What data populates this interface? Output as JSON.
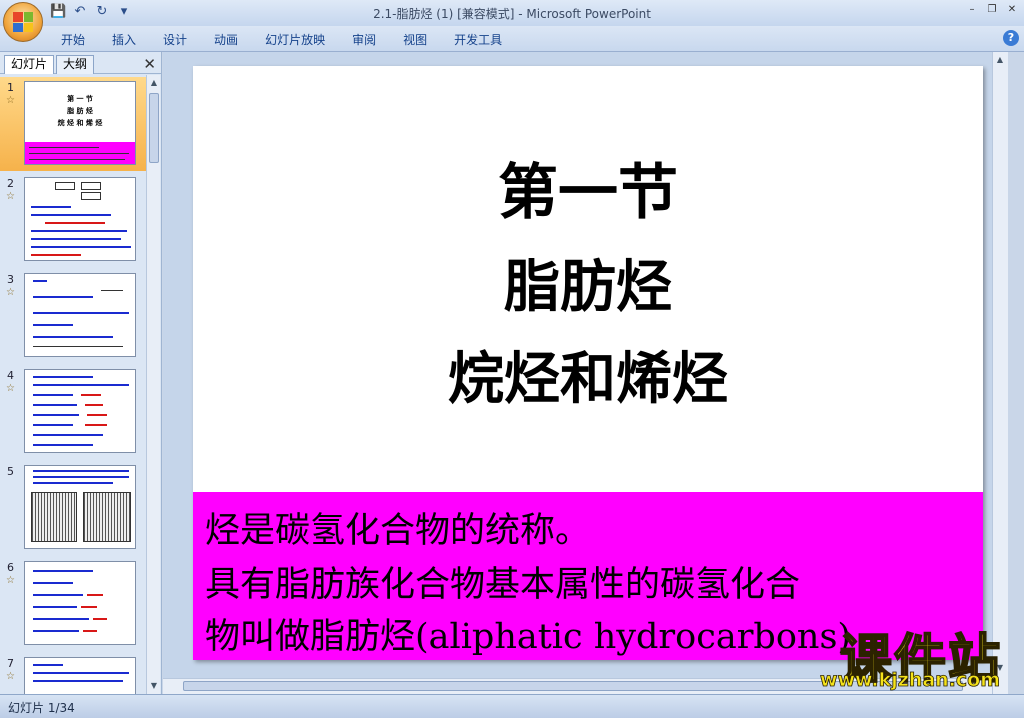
{
  "window": {
    "title": "2.1-脂肪烃 (1) [兼容模式] - Microsoft PowerPoint",
    "controls": [
      "–",
      "❐",
      "✕"
    ]
  },
  "quick_access": {
    "icons": [
      "save-icon",
      "undo-icon",
      "redo-icon",
      "customize-icon"
    ],
    "glyphs": [
      "💾",
      "↶",
      "↻",
      "▾"
    ]
  },
  "ribbon": {
    "tabs": [
      "开始",
      "插入",
      "设计",
      "动画",
      "幻灯片放映",
      "审阅",
      "视图",
      "开发工具"
    ],
    "help_label": "?"
  },
  "left_panel": {
    "tabs": [
      "幻灯片",
      "大纲"
    ],
    "close_label": "✕",
    "thumbnails": [
      {
        "number": "1",
        "selected": true
      },
      {
        "number": "2",
        "selected": false
      },
      {
        "number": "3",
        "selected": false
      },
      {
        "number": "4",
        "selected": false
      },
      {
        "number": "5",
        "selected": false
      },
      {
        "number": "6",
        "selected": false
      },
      {
        "number": "7",
        "selected": false
      }
    ],
    "thumb1_lines": [
      "第 一 节",
      "脂 肪 烃",
      "烷 烃 和 烯 烃"
    ]
  },
  "slide": {
    "title_lines": [
      "第一节",
      "脂肪烃",
      "烷烃和烯烃"
    ],
    "box_lines": [
      "烃是碳氢化合物的统称。",
      "具有脂肪族化合物基本属性的碳氢化合",
      "物叫做脂肪烃(aliphatic hydrocarbons)"
    ],
    "box_color": "#ff00ff"
  },
  "status_bar": {
    "slide_indicator": "幻灯片 1/34"
  },
  "watermark": {
    "title": "课件站",
    "url": "www.kjzhan.com"
  }
}
